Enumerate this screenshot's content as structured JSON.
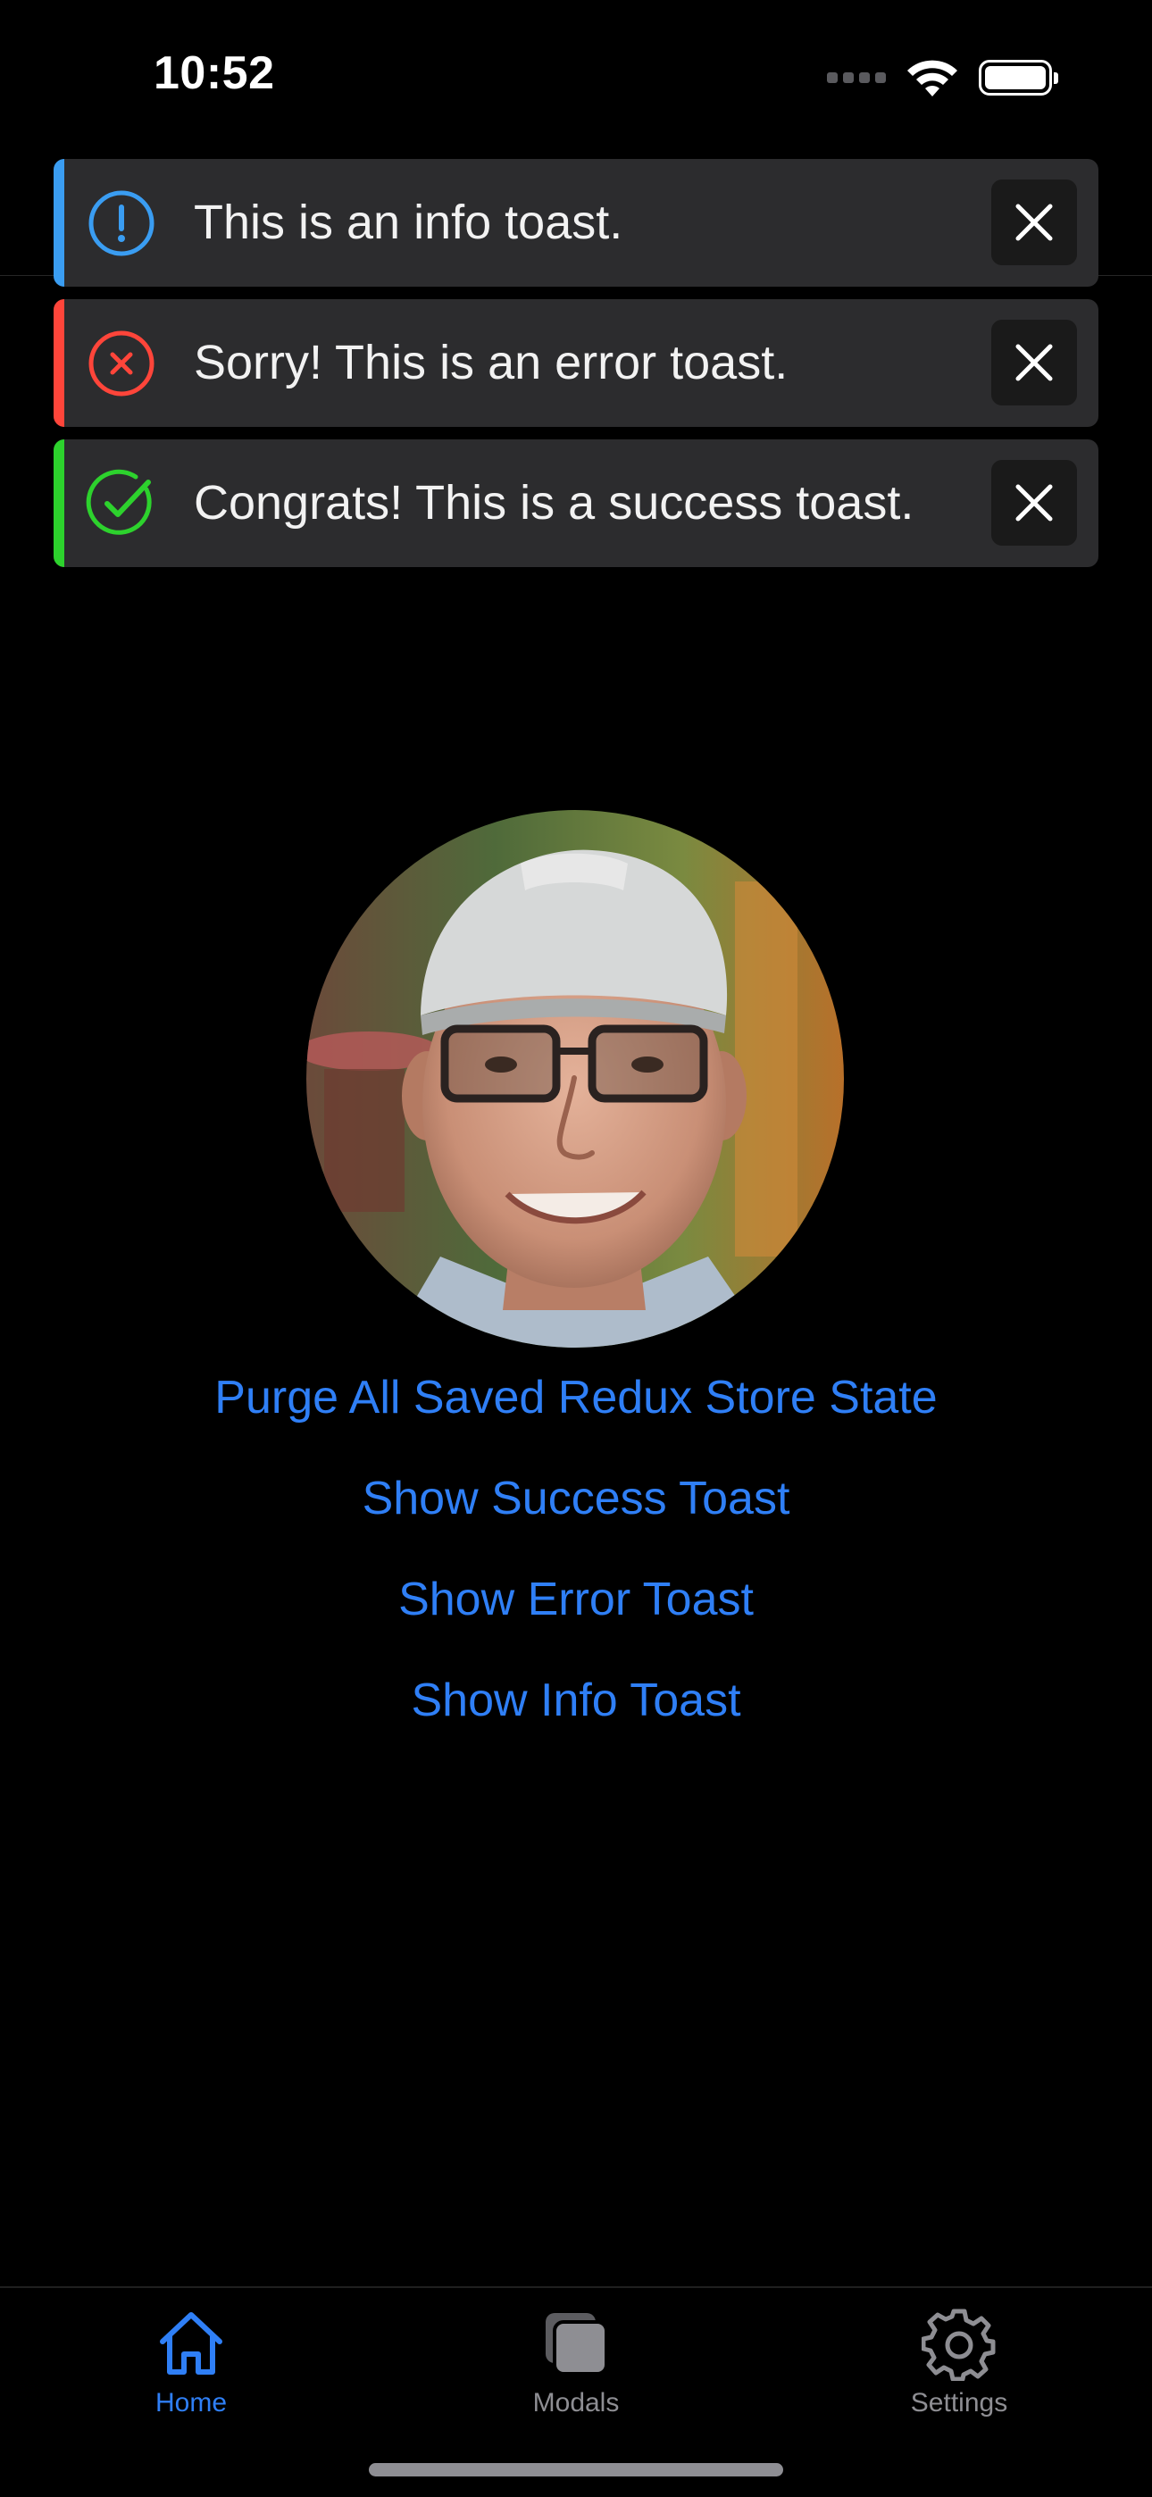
{
  "status_bar": {
    "time": "10:52"
  },
  "toasts": [
    {
      "type": "info",
      "message": "This is an info toast.",
      "accent_color": "#3a9df2",
      "icon": "exclamation-circle-icon"
    },
    {
      "type": "error",
      "message": "Sorry! This is an error toast.",
      "accent_color": "#ff453a",
      "icon": "x-circle-icon"
    },
    {
      "type": "success",
      "message": "Congrats! This is a success toast.",
      "accent_color": "#2dd22d",
      "icon": "check-circle-icon"
    }
  ],
  "actions": {
    "purge": "Purge All Saved Redux Store State",
    "show_success": "Show Success Toast",
    "show_error": "Show Error Toast",
    "show_info": "Show Info Toast"
  },
  "tab_bar": {
    "items": [
      {
        "label": "Home",
        "icon": "house-icon",
        "active": true
      },
      {
        "label": "Modals",
        "icon": "stacked-squares-icon",
        "active": false
      },
      {
        "label": "Settings",
        "icon": "gear-icon",
        "active": false
      }
    ]
  },
  "colors": {
    "background": "#000000",
    "link": "#2f7ff6",
    "tab_active": "#2f7ff6",
    "tab_inactive": "#8e8e93",
    "toast_background": "#2c2c2e"
  }
}
